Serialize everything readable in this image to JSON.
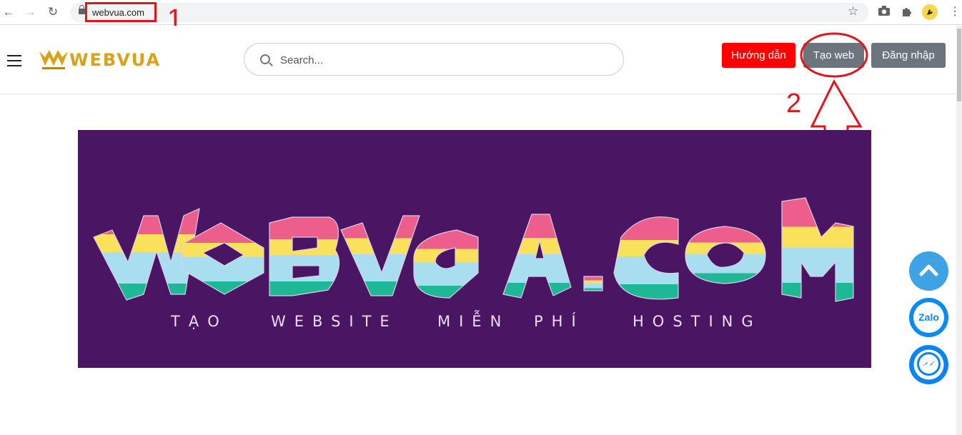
{
  "browser": {
    "url": "webvua.com"
  },
  "annotations": {
    "step1": "1",
    "step2": "2"
  },
  "header": {
    "logo_text": "WEBVUA",
    "search_placeholder": "Search...",
    "guide_button": "Hướng dẫn",
    "create_button": "Tạo web",
    "login_button": "Đăng nhập"
  },
  "banner": {
    "logo_text": "webvua.com",
    "tagline_words": [
      "TẠO",
      "WEBSITE",
      "MIỄN",
      "PHÍ",
      "HOSTING"
    ]
  },
  "floating": {
    "zalo_label": "Zalo"
  },
  "colors": {
    "guide_button": "#ff0000",
    "secondary_button": "#6c757d",
    "banner_bg": "#4a1563",
    "annotation": "#e0161c",
    "block_pink": "#ee5e8c",
    "block_yellow": "#f9e15c",
    "block_blue": "#a9def0",
    "block_green": "#1fb896"
  },
  "icons": [
    "back-icon",
    "forward-icon",
    "reload-icon",
    "lock-icon",
    "star-icon",
    "camera-icon",
    "puzzle-icon",
    "avatar",
    "menu-dots-icon",
    "hamburger-icon",
    "search-icon",
    "chevron-up-icon",
    "zalo-icon",
    "messenger-icon"
  ]
}
